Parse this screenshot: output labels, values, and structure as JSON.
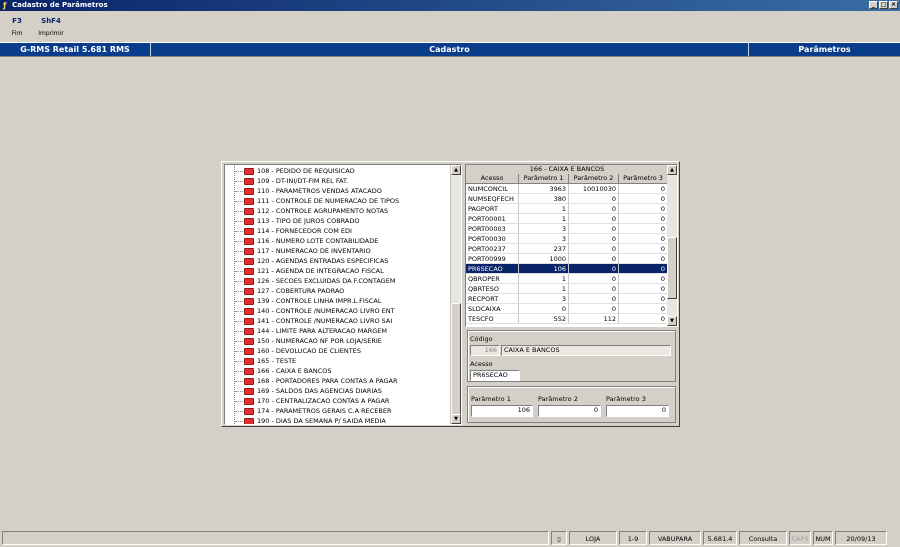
{
  "window": {
    "title": "Cadastro de Parâmetros",
    "buttons": [
      "_",
      "□",
      "×"
    ]
  },
  "toolbar": [
    {
      "key": "F3",
      "label": "Fim"
    },
    {
      "key": "ShF4",
      "label": "Imprimir"
    }
  ],
  "header": {
    "system": "G-RMS Retail 5.681 RMS",
    "module": "Cadastro",
    "screen": "Parâmetros"
  },
  "tree": {
    "items": [
      "108 - PEDIDO DE REQUISICAO",
      "109 - DT-INI/DT-FIM REL FAT.",
      "110 - PARAMETROS VENDAS ATACADO",
      "111 - CONTROLE DE NUMERACAO DE TIPOS",
      "112 - CONTROLE AGRUPAMENTO NOTAS",
      "113 - TIPO DE JUROS COBRADO",
      "114 - FORNECEDOR COM EDI",
      "116 - NUMERO LOTE CONTABILIDADE",
      "117 - NUMERACAO DE INVENTARIO",
      "120 - AGENDAS ENTRADAS ESPECIFICAS",
      "121 - AGENDA DE INTEGRACAO FISCAL",
      "126 - SECOES EXCLUIDAS DA F.CONTAGEM",
      "127 - COBERTURA PADRAO",
      "139 - CONTROLE LINHA IMPR.L.FISCAL",
      "140 - CONTROLE /NUMERACAO LIVRO ENT",
      "141 - CONTROLE /NUMERACAO LIVRO SAI",
      "144 - LIMITE PARA ALTERACAO MARGEM",
      "150 - NUMERACAO NF POR LOJA/SERIE",
      "160 - DEVOLUCAO DE CLIENTES",
      "165 - TESTE",
      "166 - CAIXA E BANCOS",
      "168 - PORTADORES PARA CONTAS A PAGAR",
      "169 - SALDOS DAS AGENCIAS DIARIAS",
      "170 - CENTRALIZACAO CONTAS A PAGAR",
      "174 - PARAMETROS GERAIS C.A RECEBER",
      "190 - DIAS DA SEMANA P/ SAIDA MEDIA"
    ]
  },
  "grid": {
    "title": "166 - CAIXA E BANCOS",
    "columns": [
      "Acesso",
      "Parâmetro 1",
      "Parâmetro 2",
      "Parâmetro 3"
    ],
    "rows": [
      [
        "NUMCONCIL",
        "3963",
        "10010030",
        "0"
      ],
      [
        "NUMSEQFECH",
        "380",
        "0",
        "0"
      ],
      [
        "PAGPORT",
        "1",
        "0",
        "0"
      ],
      [
        "PORT00001",
        "1",
        "0",
        "0"
      ],
      [
        "PORT00003",
        "3",
        "0",
        "0"
      ],
      [
        "PORT00030",
        "3",
        "0",
        "0"
      ],
      [
        "PORT00237",
        "237",
        "0",
        "0"
      ],
      [
        "PORT00999",
        "1000",
        "0",
        "0"
      ],
      [
        "PR6SECAO",
        "106",
        "0",
        "0"
      ],
      [
        "QBROPER",
        "1",
        "0",
        "0"
      ],
      [
        "QBRTESO",
        "1",
        "0",
        "0"
      ],
      [
        "RECPORT",
        "3",
        "0",
        "0"
      ],
      [
        "SLDCAIXA",
        "0",
        "0",
        "0"
      ],
      [
        "TESCFO",
        "552",
        "112",
        "0"
      ]
    ],
    "selected_row": 8
  },
  "form": {
    "codigo_label": "Código",
    "codigo_value": "166",
    "codigo_desc": "CAIXA E BANCOS",
    "acesso_label": "Acesso",
    "acesso_value": "PR6SECAO",
    "p1_label": "Parâmetro 1",
    "p1_value": "106",
    "p2_label": "Parâmetro 2",
    "p2_value": "0",
    "p3_label": "Parâmetro 3",
    "p3_value": "0"
  },
  "status": {
    "loja": "LOJA",
    "range": "1-9",
    "user": "VABUPARA",
    "version": "5.681.4",
    "mode": "Consulta",
    "caps": "CAPS",
    "num": "NUM",
    "date": "20/09/13"
  },
  "colors": {
    "accent": "#0a3c8c",
    "selection": "#0a246a",
    "folder": "#e03030"
  }
}
